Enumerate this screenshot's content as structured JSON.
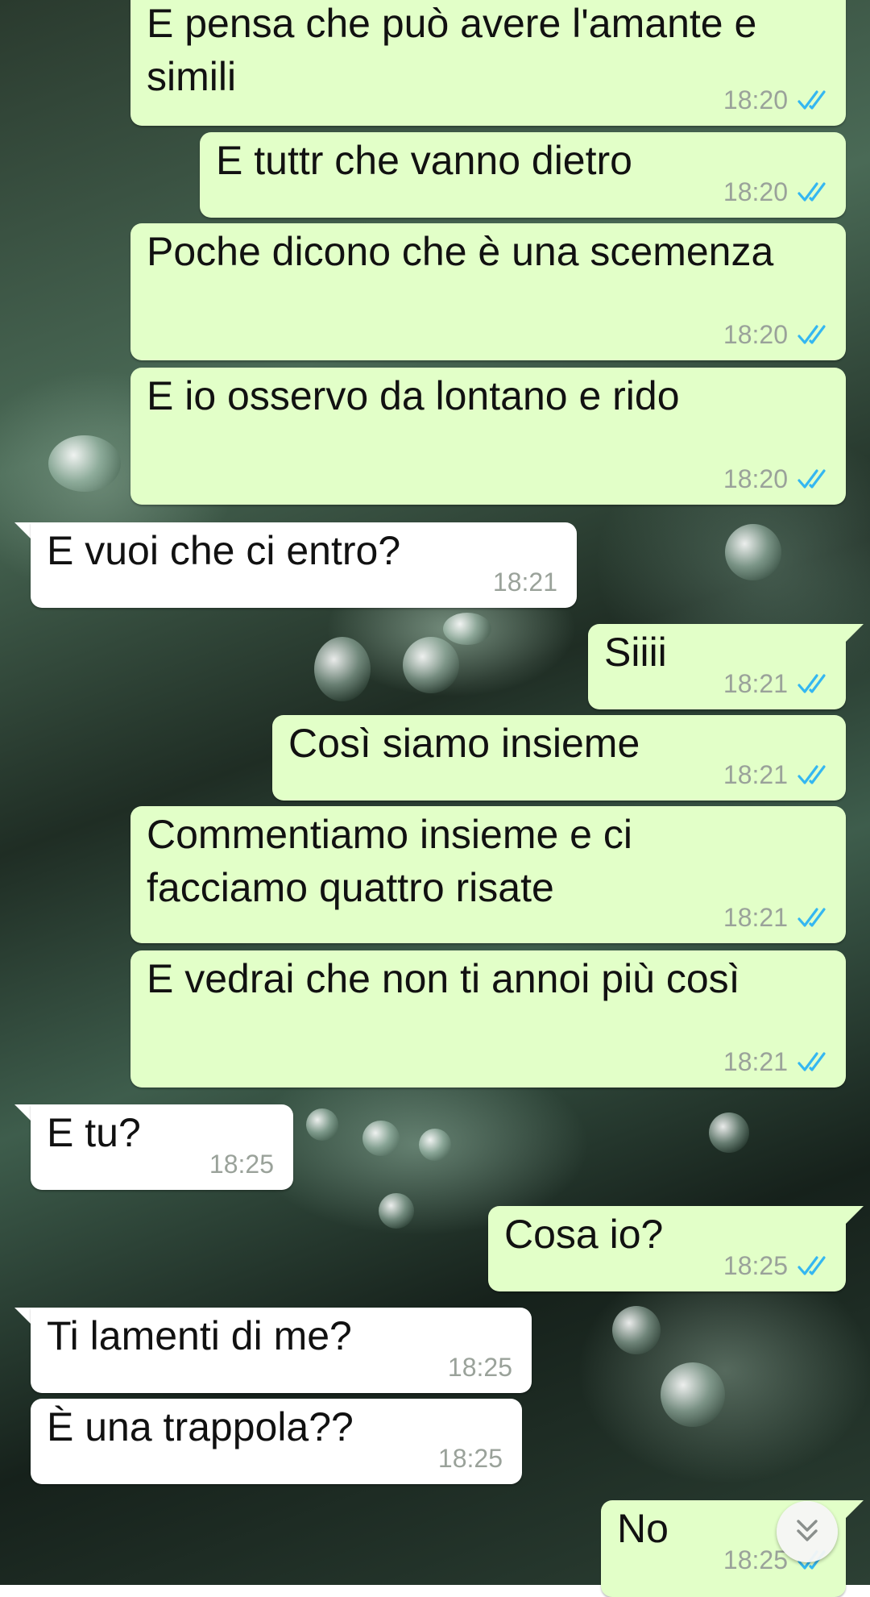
{
  "chat": {
    "messages": [
      {
        "direction": "out",
        "text": "E pensa che può avere l'amante e simili",
        "time": "18:20",
        "status": "read"
      },
      {
        "direction": "out",
        "text": "E tuttr che vanno dietro",
        "time": "18:20",
        "status": "read"
      },
      {
        "direction": "out",
        "text": "Poche dicono che è una scemenza",
        "time": "18:20",
        "status": "read"
      },
      {
        "direction": "out",
        "text": "E io osservo da lontano e rido",
        "time": "18:20",
        "status": "read"
      },
      {
        "direction": "in",
        "text": "E vuoi che ci entro?",
        "time": "18:21"
      },
      {
        "direction": "out",
        "text": "Siiii",
        "time": "18:21",
        "status": "read"
      },
      {
        "direction": "out",
        "text": "Così siamo insieme",
        "time": "18:21",
        "status": "read"
      },
      {
        "direction": "out",
        "text": "Commentiamo insieme e ci facciamo quattro risate",
        "time": "18:21",
        "status": "read"
      },
      {
        "direction": "out",
        "text": "E vedrai che non ti annoi più così",
        "time": "18:21",
        "status": "read"
      },
      {
        "direction": "in",
        "text": "E tu?",
        "time": "18:25"
      },
      {
        "direction": "out",
        "text": "Cosa io?",
        "time": "18:25",
        "status": "read"
      },
      {
        "direction": "in",
        "text": "Ti lamenti di me?",
        "time": "18:25"
      },
      {
        "direction": "in",
        "text": "È una trappola??",
        "time": "18:25"
      },
      {
        "direction": "out",
        "text": "No",
        "time": "18:25",
        "status": "read"
      }
    ]
  },
  "colors": {
    "outgoing_bubble": "#e2ffc8",
    "incoming_bubble": "#ffffff",
    "read_ticks": "#34b7f1",
    "timestamp": "#9aa29a"
  },
  "icons": {
    "read_status": "double-check-icon",
    "scroll": "double-chevron-down-icon"
  }
}
